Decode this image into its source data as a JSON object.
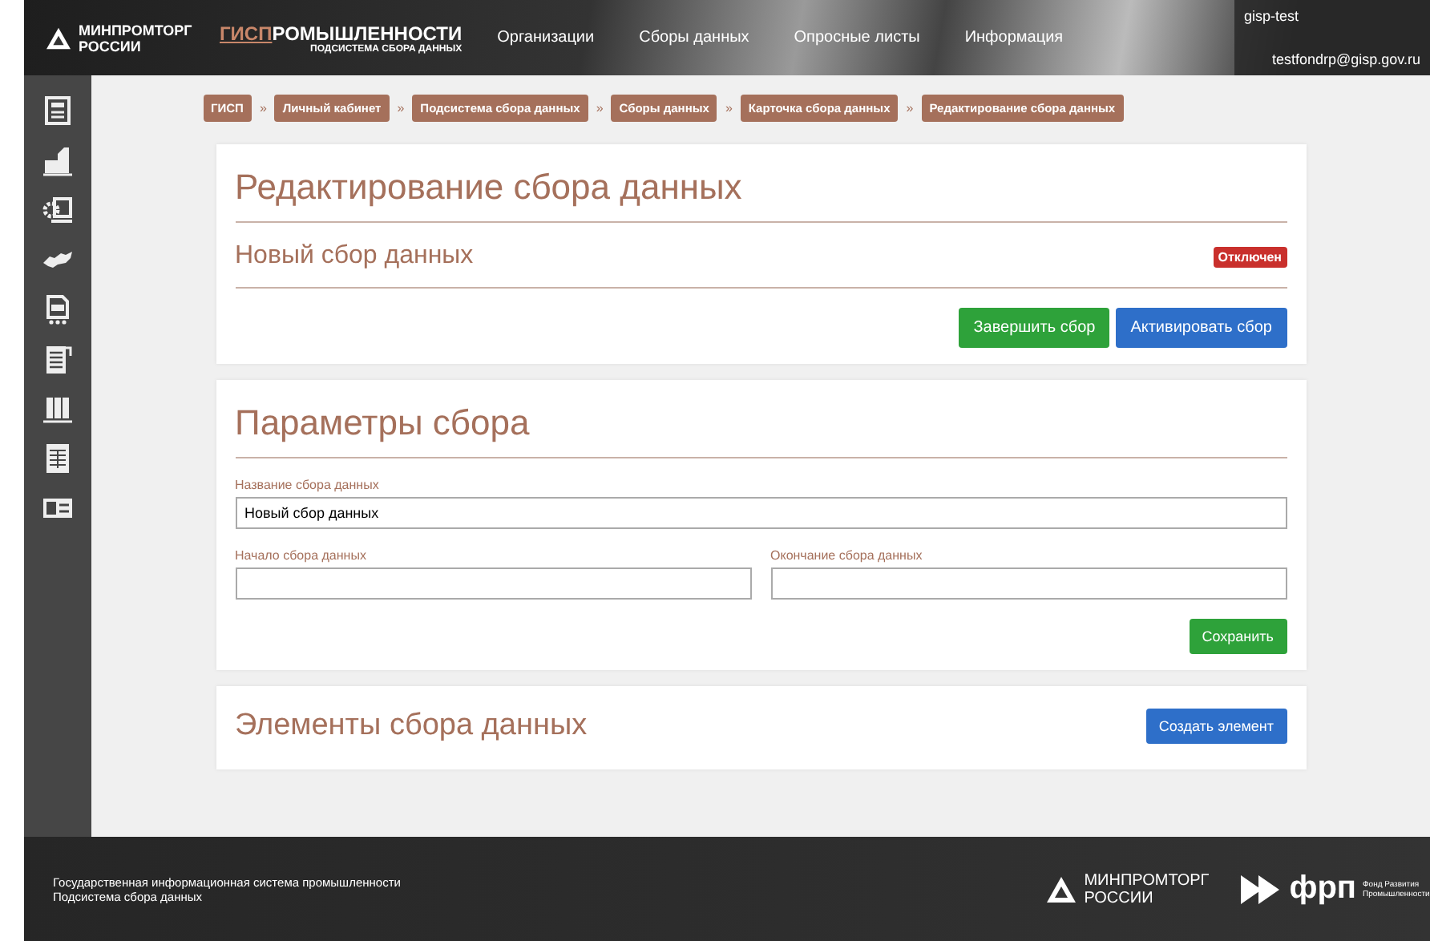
{
  "header": {
    "ministry_logo": "МИНПРОМТОРГ РОССИИ",
    "brand_prefix": "ГИСП",
    "brand_rest": "РОМЫШЛЕННОСТИ",
    "brand_sub": "ПОДСИСТЕМА СБОРА ДАННЫХ",
    "nav": [
      "Организации",
      "Сборы данных",
      "Опросные листы",
      "Информация"
    ],
    "user": {
      "login": "gisp-test",
      "email": "testfondrp@gisp.gov.ru"
    }
  },
  "sidebar": {
    "items": [
      {
        "kind": "newspaper"
      },
      {
        "kind": "factory"
      },
      {
        "kind": "gear-screen"
      },
      {
        "kind": "map"
      },
      {
        "kind": "form"
      },
      {
        "kind": "document"
      },
      {
        "kind": "columns"
      },
      {
        "kind": "table"
      },
      {
        "kind": "id-card"
      }
    ]
  },
  "breadcrumbs": {
    "separator": "»",
    "items": [
      "ГИСП",
      "Личный кабинет",
      "Подсистема сбора данных",
      "Сборы данных",
      "Карточка сбора данных",
      "Редактирование сбора данных"
    ]
  },
  "edit_card": {
    "title": "Редактирование сбора данных",
    "name": "Новый сбор данных",
    "status": "Отключен",
    "buttons": [
      {
        "label": "Завершить сбор",
        "kind": "success"
      },
      {
        "label": "Активировать сбор",
        "kind": "primary"
      }
    ]
  },
  "params_card": {
    "title": "Параметры сбора",
    "fields": [
      {
        "label": "Название сбора данных",
        "value": "Новый сбор данных"
      },
      {
        "label": "Начало сбора данных"
      },
      {
        "label": "Окончание сбора данных"
      }
    ],
    "save_button": {
      "label": "Сохранить",
      "kind": "success"
    }
  },
  "elements_card": {
    "title": "Элементы сбора данных",
    "create_button": {
      "label": "Создать элемент",
      "kind": "primary"
    }
  },
  "footer": {
    "lines": [
      "Государственная информационная система промышленности",
      "Подсистема сбора данных"
    ],
    "ministry_logo": "МИНПРОМТОРГ РОССИИ",
    "frp_logo": "фрп",
    "frp_caption": "Фонд Развития Промышленности"
  }
}
